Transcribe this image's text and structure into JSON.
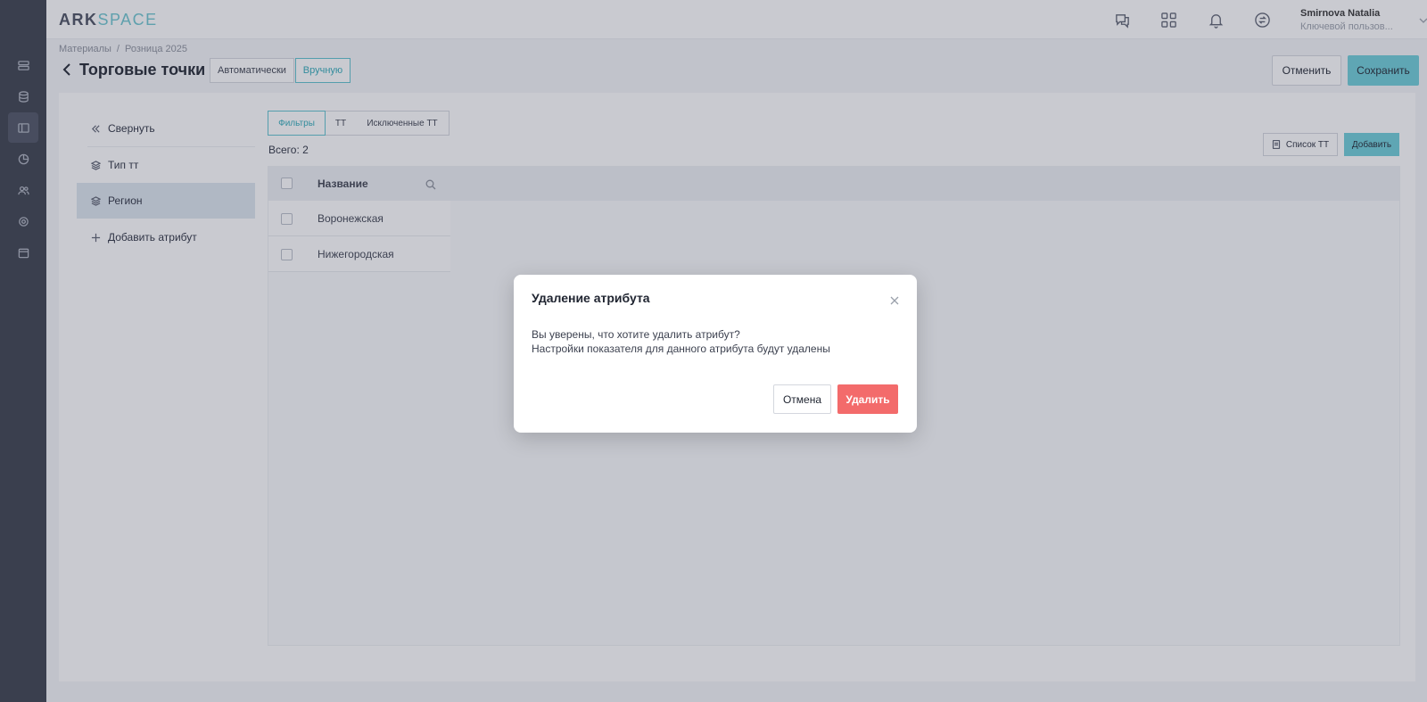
{
  "app": {
    "logo_part1": "ARK",
    "logo_part2": "SPACE"
  },
  "rail": {
    "items": [
      {
        "icon": "list-icon"
      },
      {
        "icon": "database-icon"
      },
      {
        "icon": "layout-icon",
        "active": true
      },
      {
        "icon": "pie-chart-icon"
      },
      {
        "icon": "users-icon"
      },
      {
        "icon": "settings-icon"
      },
      {
        "icon": "calendar-icon"
      }
    ]
  },
  "topbar": {
    "icons": [
      "help-chat-icon",
      "apps-grid-icon",
      "bell-icon",
      "sync-icon"
    ],
    "user_name": "Smirnova Natalia",
    "user_role": "Ключевой пользов..."
  },
  "header": {
    "breadcrumb": [
      "Материалы",
      "Розница 2025"
    ],
    "title": "Торговые точки",
    "mode_auto": "Автоматически",
    "mode_manual": "Вручную",
    "cancel": "Отменить",
    "save": "Сохранить"
  },
  "sidebar": {
    "collapse": "Свернуть",
    "items": [
      {
        "label": "Тип тт"
      },
      {
        "label": "Регион",
        "active": true
      }
    ],
    "add_attribute": "Добавить атрибут"
  },
  "content": {
    "tabs": [
      "Фильтры",
      "ТТ",
      "Исключенные ТТ"
    ],
    "total": "Всего: 2",
    "list_button": "Список ТТ",
    "add_button": "Добавить",
    "table": {
      "header": "Название",
      "rows": [
        "Воронежская",
        "Нижегородская"
      ]
    }
  },
  "modal": {
    "title": "Удаление атрибута",
    "line1": "Вы уверены, что хотите удалить атрибут?",
    "line2": "Настройки показателя для данного атрибута будут удалены",
    "cancel": "Отмена",
    "confirm": "Удалить"
  },
  "colors": {
    "accent": "#6ccdd8",
    "danger": "#f36b6b",
    "rail": "#3a3f4b"
  }
}
